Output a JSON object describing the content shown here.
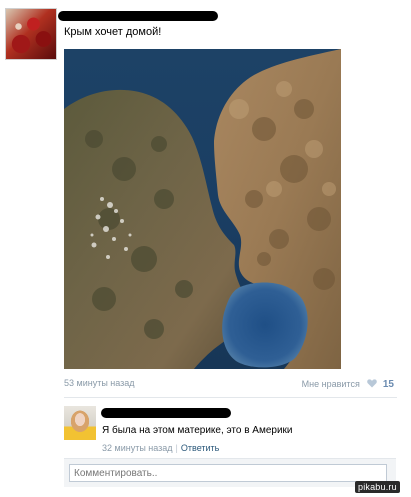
{
  "post": {
    "text": "Крым хочет домой!",
    "time": "53 минуты назад",
    "like_label": "Мне нравится",
    "like_count": "15"
  },
  "comment": {
    "text": "Я была на этом материке, это в Америки",
    "time": "32 минуты назад",
    "reply_label": "Ответить"
  },
  "comment_box": {
    "placeholder": "Комментировать.."
  },
  "watermark": "pikabu.ru",
  "colors": {
    "meta_gray": "#8a9aa8",
    "link_blue": "#2b587a",
    "like_heart": "#b8c8d8"
  },
  "icons": {
    "like": "heart-icon"
  }
}
